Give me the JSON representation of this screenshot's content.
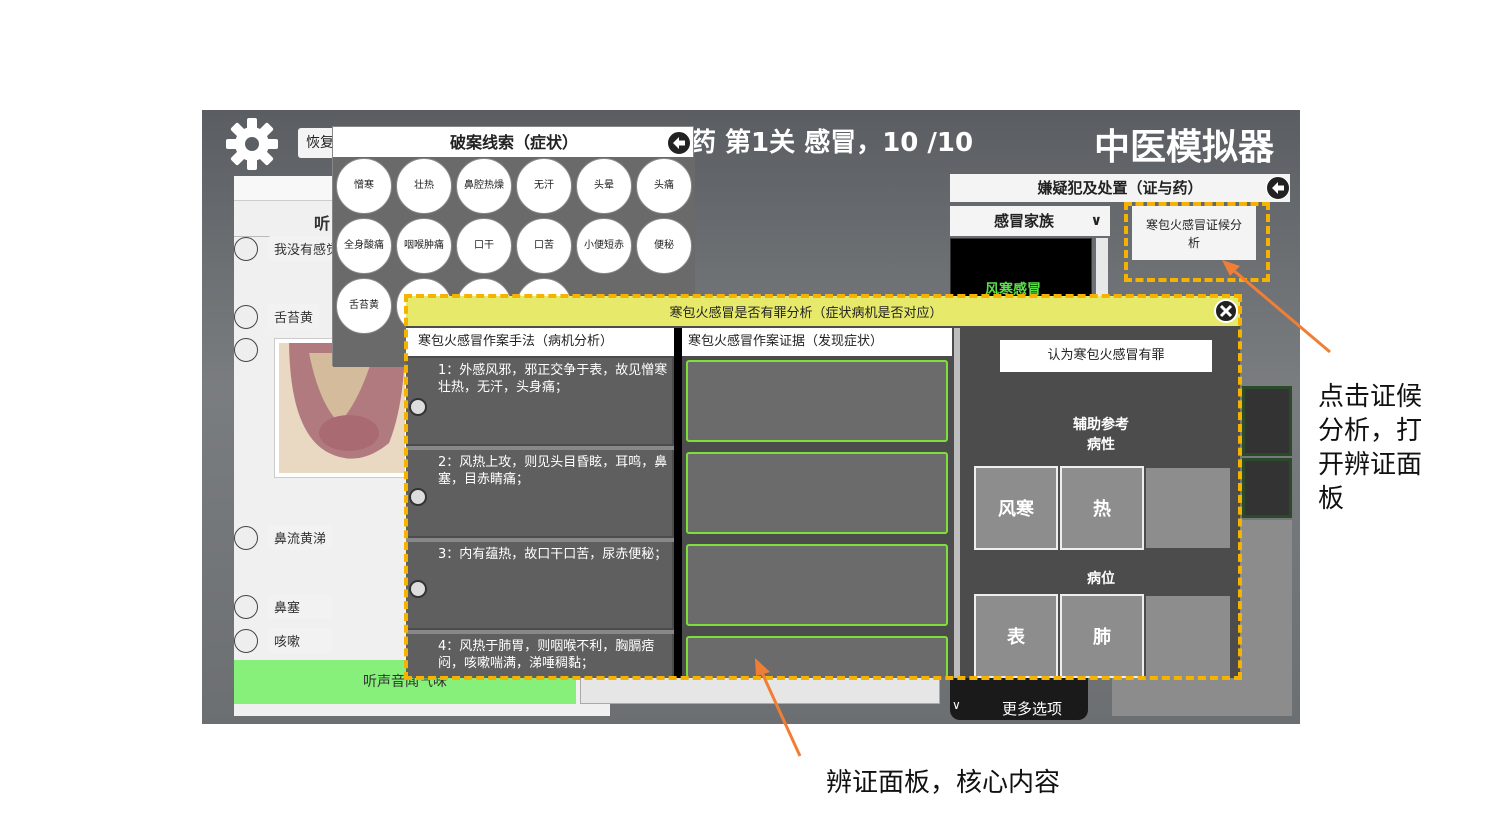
{
  "game": {
    "header_level": "药 第1关 感冒，10 /10",
    "app_title": "中医模拟器",
    "restore_label": "恢复"
  },
  "left_panel": {
    "subtitle_partial": "听",
    "chat": [
      {
        "text": "我没有感觉"
      },
      {
        "text": "舌苔黄"
      },
      {
        "text": "鼻流黄涕"
      },
      {
        "text": "鼻塞"
      },
      {
        "text": "咳嗽"
      }
    ],
    "listen_button": "听声音闻气味"
  },
  "clue_popup": {
    "title": "破案线索（症状）",
    "clues": [
      "憎寒",
      "壮热",
      "鼻腔热燥",
      "无汗",
      "头晕",
      "头痛",
      "全身酸痛",
      "咽喉肿痛",
      "口干",
      "口苦",
      "小便短赤",
      "便秘",
      "舌苔黄"
    ]
  },
  "suspect_panel": {
    "title": "嫌疑犯及处置（证与药）",
    "family_select": "感冒家族",
    "disease_label": "风寒感冒",
    "analysis_button": "寒包火感冒证候分析",
    "more_options": "更多选项"
  },
  "analysis_panel": {
    "title": "寒包火感冒是否有罪分析（症状病机是否对应）",
    "col_mechanism": "寒包火感冒作案手法（病机分析）",
    "col_evidence": "寒包火感冒作案证据（发现症状）",
    "items": [
      {
        "text": "1：外感风邪，邪正交争于表，故见憎寒壮热，无汗，头身痛；"
      },
      {
        "text": "2：风热上攻，则见头目昏眩，耳鸣，鼻塞，目赤睛痛；"
      },
      {
        "text": "3：内有蕴热，故口干口苦，尿赤便秘；"
      },
      {
        "text": "4：风热于肺胃，则咽喉不利，胸膈痞闷，咳嗽喘满，涕唾稠黏；"
      }
    ],
    "guilty_button": "认为寒包火感冒有罪",
    "aux_label": "辅助参考",
    "nature_label": "病性",
    "nature_options": [
      "风寒",
      "热"
    ],
    "location_label": "病位",
    "location_options": [
      "表",
      "肺"
    ]
  },
  "annotations": {
    "right_note": "点击证候分析，打开辨证面板",
    "bottom_note": "辨证面板，核心内容"
  },
  "colors": {
    "accent_yellow": "#f5b300",
    "arrow_orange": "#f07f35",
    "evidence_green": "#7de03a",
    "listen_green": "#87f07a"
  }
}
